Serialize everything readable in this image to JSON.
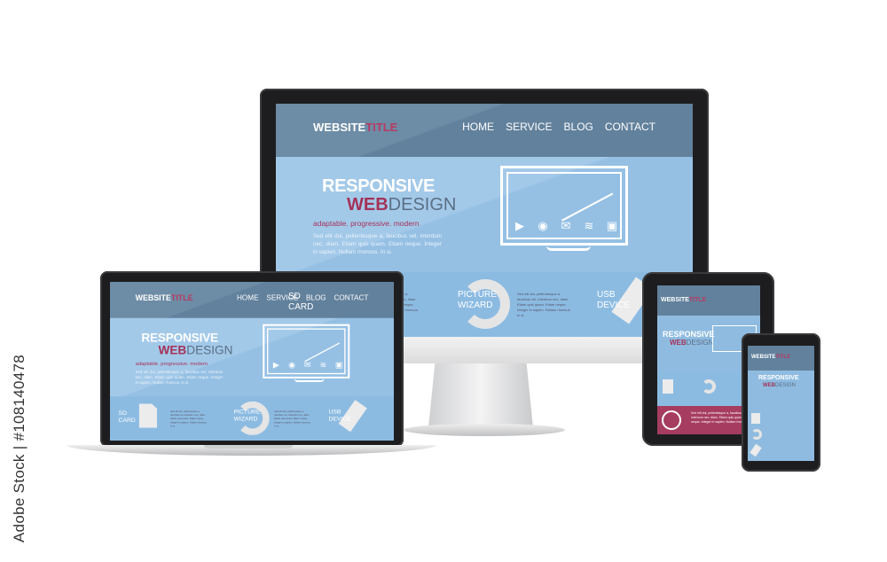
{
  "site": {
    "title_a": "WEBSITE",
    "title_b": "TITLE",
    "nav": [
      "HOME",
      "SERVICE",
      "BLOG",
      "CONTACT"
    ],
    "heading1": "RESPONSIVE",
    "heading2a": "WEB",
    "heading2b": "DESIGN",
    "tagline": "adaptable. progressive. modern",
    "body": "Sed elit dui, pellentesque a, faucibus vel, interdum nec, diam. Etiam quis quam. Etiam neque. Integer in sapien. Nullam rhoncus. In si.",
    "features": [
      "SD CARD",
      "PICTURE WIZARD",
      "USB DEVICE"
    ],
    "icons": [
      "play-icon",
      "globe-icon",
      "mail-icon",
      "wifi-icon",
      "image-icon"
    ]
  },
  "colors": {
    "header": "#62819c",
    "hero": "#95c0e4",
    "accent": "#b73a63",
    "bezel": "#1d1d1f"
  },
  "watermark": "Adobe Stock | #108140478"
}
